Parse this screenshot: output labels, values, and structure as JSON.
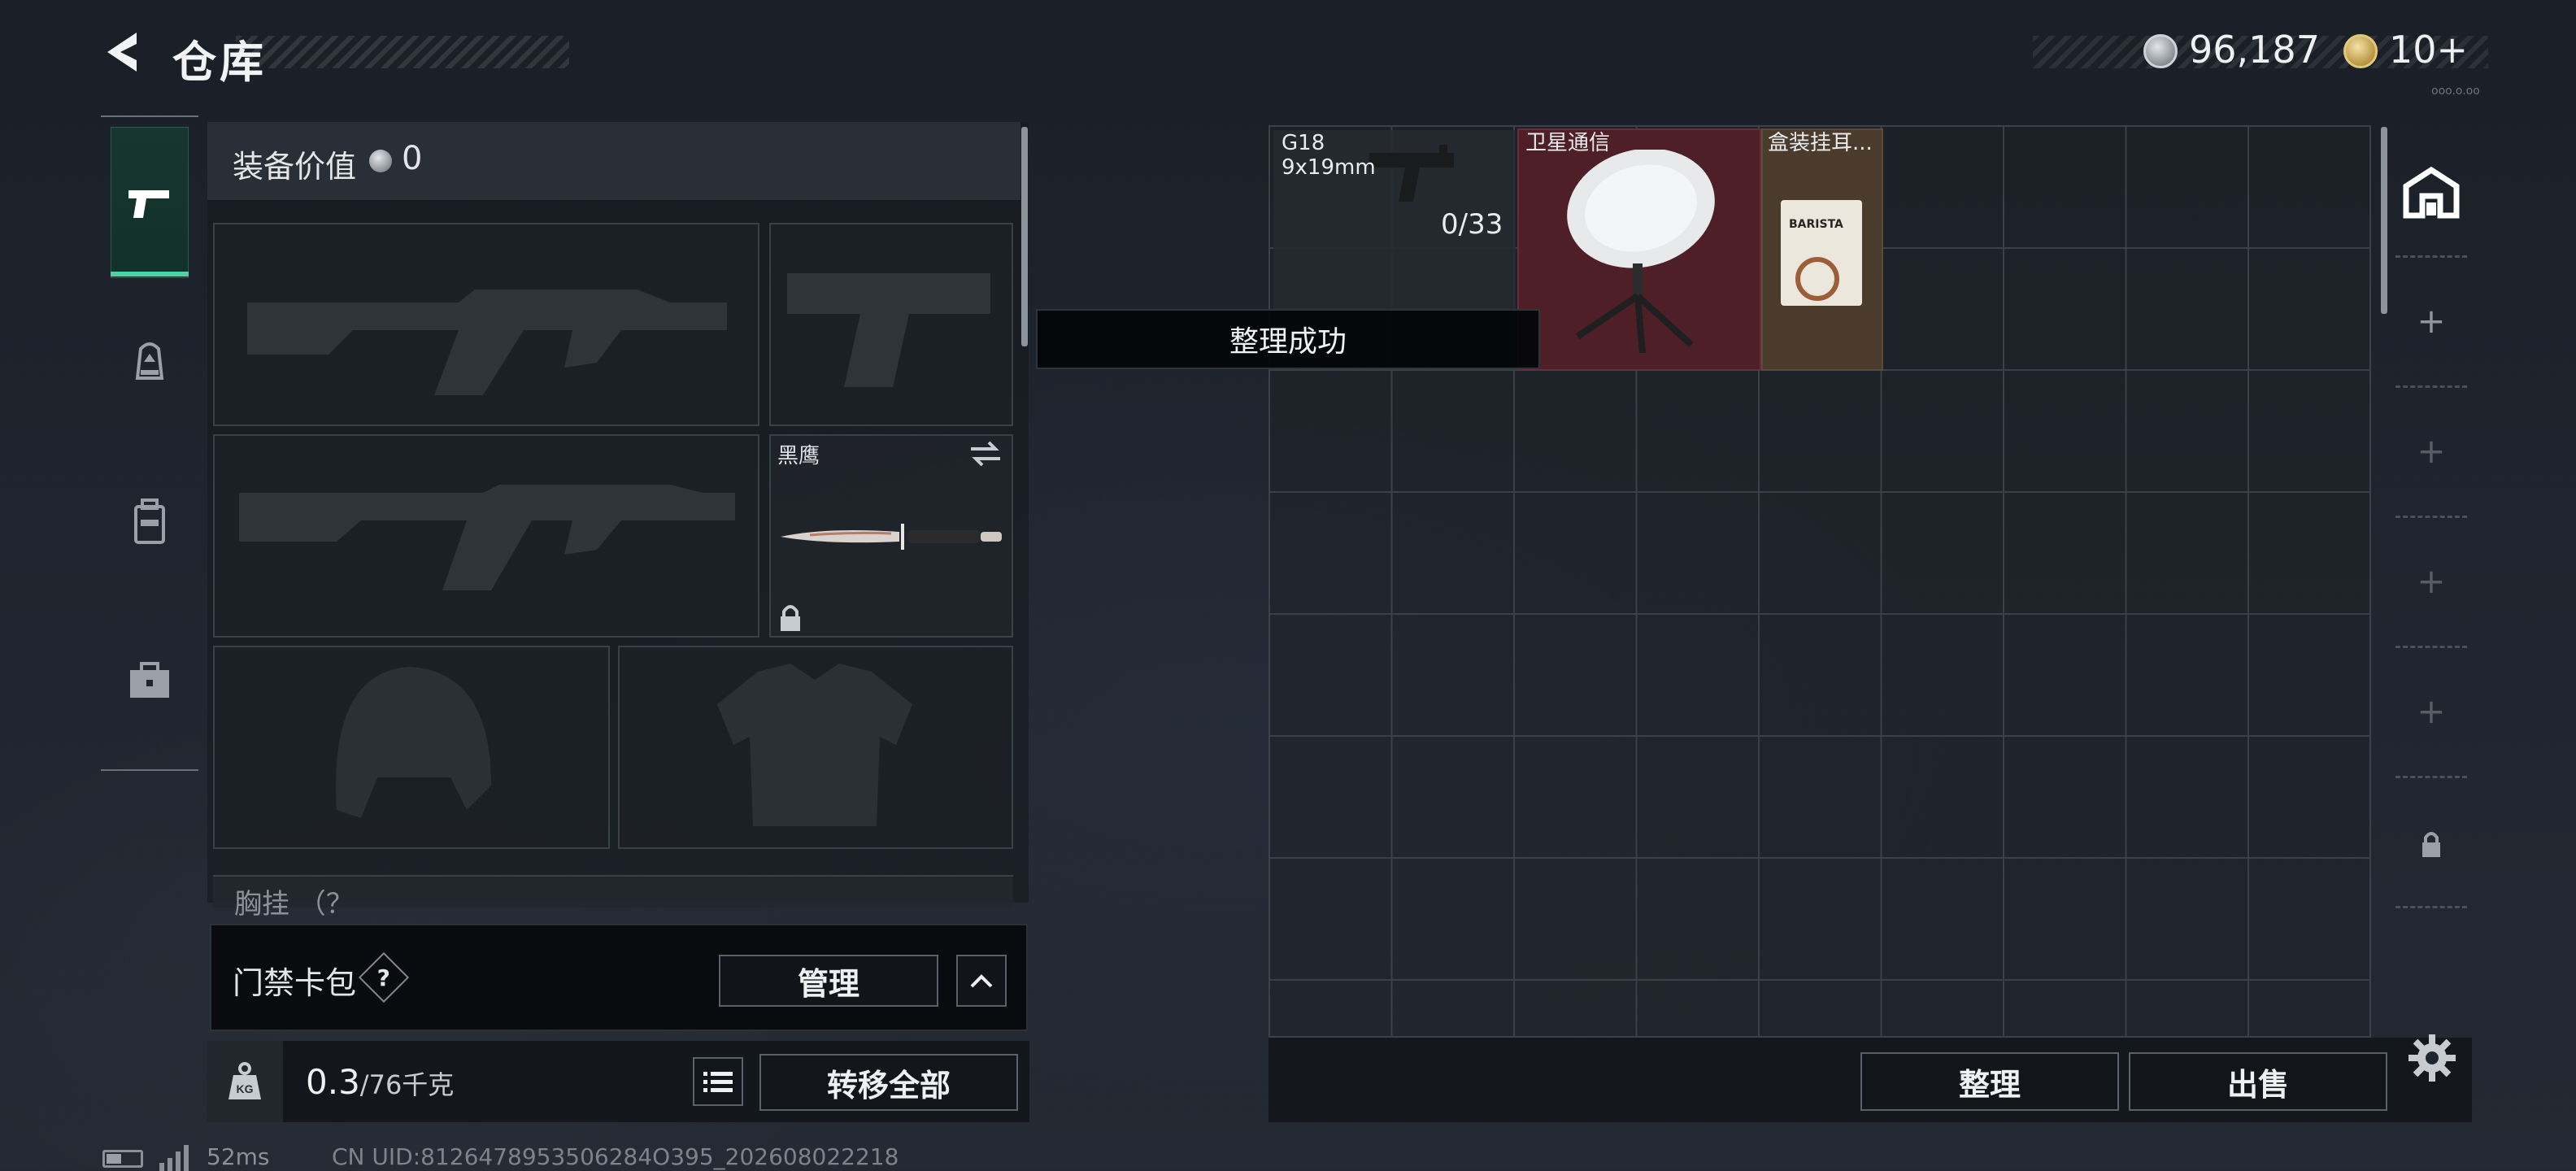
{
  "header": {
    "title": "仓库",
    "currency_silver": "96,187",
    "currency_gold": "10+",
    "small_text": "ooo.o.oo"
  },
  "tabs": [
    {
      "name": "weapons",
      "icon": "pistol-icon",
      "active": true
    },
    {
      "name": "gear",
      "icon": "helmet-bag-icon",
      "active": false
    },
    {
      "name": "backpack",
      "icon": "backpack-icon",
      "active": false
    },
    {
      "name": "toolkit",
      "icon": "briefcase-icon",
      "active": false
    }
  ],
  "loadout": {
    "header_label": "装备价值",
    "header_value": "0",
    "knife_name": "黑鹰",
    "chest_label": "胸挂 （？"
  },
  "access_card": {
    "label": "门禁卡包",
    "help": "?",
    "manage_label": "管理"
  },
  "weight": {
    "current": "0.3",
    "capacity": "/76千克",
    "transfer_label": "转移全部"
  },
  "toast": {
    "text": "整理成功"
  },
  "warehouse": {
    "items": [
      {
        "name": "G18",
        "caliber": "9x19mm",
        "count": "0/33"
      },
      {
        "name": "卫星通信"
      },
      {
        "name": "盒装挂耳..."
      }
    ],
    "sort_label": "整理",
    "sell_label": "出售"
  },
  "status": {
    "ping": "52ms",
    "uid": "CN UID:8126478953506284O395_202608022218"
  },
  "colors": {
    "accent": "#4fd1a6",
    "rare_red": "#4e1f26",
    "item_brown": "#4a3b2d"
  }
}
